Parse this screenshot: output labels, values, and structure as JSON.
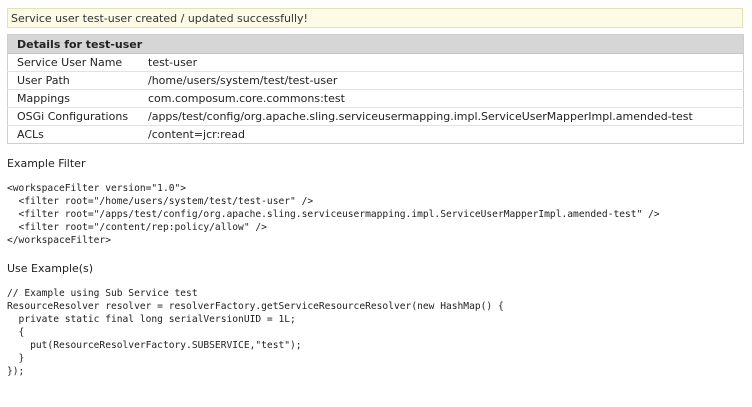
{
  "notice": "Service user test-user created / updated successfully!",
  "details": {
    "heading": "Details for test-user",
    "rows": [
      {
        "key": "Service User Name",
        "value": "test-user"
      },
      {
        "key": "User Path",
        "value": "/home/users/system/test/test-user"
      },
      {
        "key": "Mappings",
        "value": "com.composum.core.commons:test"
      },
      {
        "key": "OSGi Configurations",
        "value": "/apps/test/config/org.apache.sling.serviceusermapping.impl.ServiceUserMapperImpl.amended-test"
      },
      {
        "key": "ACLs",
        "value": "/content=jcr:read"
      }
    ]
  },
  "example_filter": {
    "label": "Example Filter",
    "lines": [
      "<workspaceFilter version=\"1.0\">",
      "  <filter root=\"/home/users/system/test/test-user\" />",
      "  <filter root=\"/apps/test/config/org.apache.sling.serviceusermapping.impl.ServiceUserMapperImpl.amended-test\" />",
      "  <filter root=\"/content/rep:policy/allow\" />",
      "</workspaceFilter>"
    ]
  },
  "use_example": {
    "label": "Use Example(s)",
    "lines": [
      "// Example using Sub Service test",
      "ResourceResolver resolver = resolverFactory.getServiceResourceResolver(new HashMap() {",
      "  private static final long serialVersionUID = 1L;",
      "  {",
      "    put(ResourceResolverFactory.SUBSERVICE,\"test\");",
      "  }",
      "});"
    ]
  }
}
